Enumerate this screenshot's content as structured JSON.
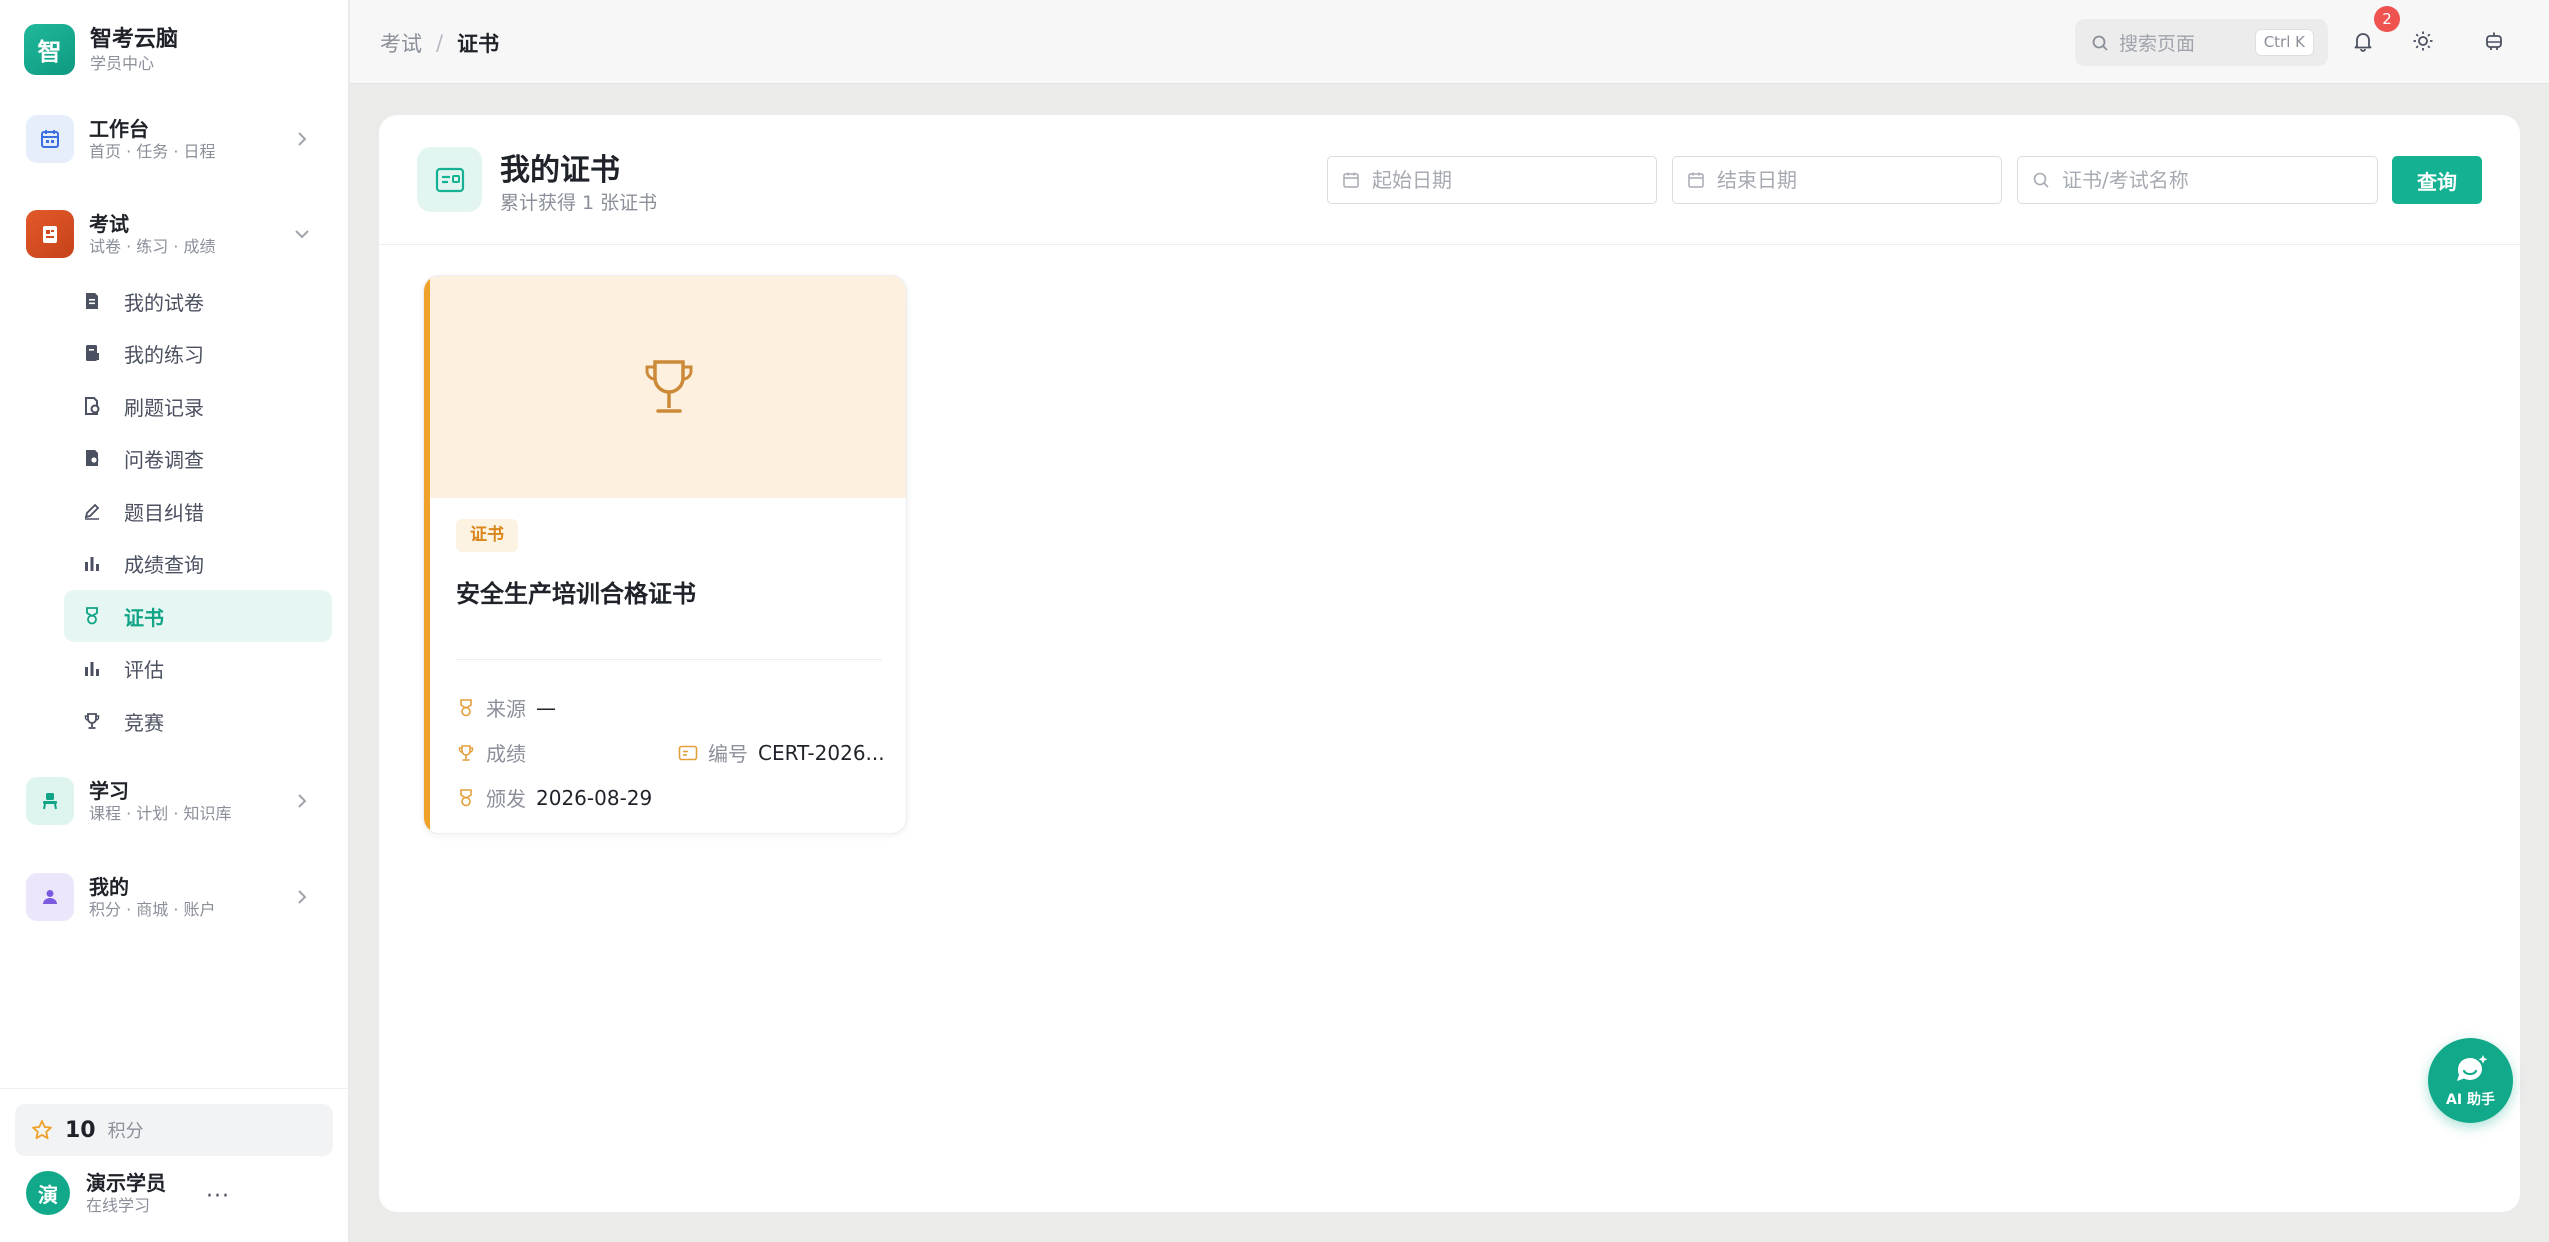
{
  "brand": {
    "logo_char": "智",
    "title": "智考云脑",
    "subtitle": "学员中心"
  },
  "sidebar": {
    "groups": [
      {
        "title": "工作台",
        "subtitle": "首页 · 任务 · 日程",
        "icon": "calendar-icon",
        "expanded": false
      },
      {
        "title": "考试",
        "subtitle": "试卷 · 练习 · 成绩",
        "icon": "exam-icon",
        "expanded": true
      },
      {
        "title": "学习",
        "subtitle": "课程 · 计划 · 知识库",
        "icon": "study-icon",
        "expanded": false
      },
      {
        "title": "我的",
        "subtitle": "积分 · 商城 · 账户",
        "icon": "user-icon",
        "expanded": false
      }
    ],
    "exam_items": [
      {
        "label": "我的试卷",
        "icon": "paper-icon",
        "active": false
      },
      {
        "label": "我的练习",
        "icon": "practice-icon",
        "active": false
      },
      {
        "label": "刷题记录",
        "icon": "record-icon",
        "active": false
      },
      {
        "label": "问卷调查",
        "icon": "survey-icon",
        "active": false
      },
      {
        "label": "题目纠错",
        "icon": "pen-icon",
        "active": false
      },
      {
        "label": "成绩查询",
        "icon": "bar-chart-icon",
        "active": false
      },
      {
        "label": "证书",
        "icon": "medal-icon",
        "active": true
      },
      {
        "label": "评估",
        "icon": "bar-chart-icon",
        "active": false
      },
      {
        "label": "竞赛",
        "icon": "trophy-icon",
        "active": false
      }
    ],
    "points": {
      "value": "10",
      "unit": "积分"
    },
    "user": {
      "avatar_char": "演",
      "name": "演示学员",
      "status": "在线学习",
      "more": "···"
    }
  },
  "topbar": {
    "breadcrumb": {
      "parent": "考试",
      "separator": "/",
      "current": "证书"
    },
    "search": {
      "placeholder": "搜索页面",
      "shortcut": "Ctrl K"
    },
    "notification_count": "2"
  },
  "page": {
    "title": "我的证书",
    "subtitle": "累计获得 1 张证书",
    "filters": {
      "start_date_placeholder": "起始日期",
      "end_date_placeholder": "结束日期",
      "keyword_placeholder": "证书/考试名称",
      "query_label": "查询"
    }
  },
  "certificates": [
    {
      "tag": "证书",
      "name": "安全生产培训合格证书",
      "source_label": "来源",
      "source_value": "—",
      "score_label": "成绩",
      "score_value": "",
      "number_label": "编号",
      "number_value": "CERT-2026...",
      "issued_label": "颁发",
      "issued_value": "2026-08-29"
    }
  ],
  "ai_helper": {
    "label": "AI 助手"
  },
  "colors": {
    "primary": "#14b292",
    "accent_orange": "#f0a12a",
    "badge_red": "#ef5350"
  }
}
